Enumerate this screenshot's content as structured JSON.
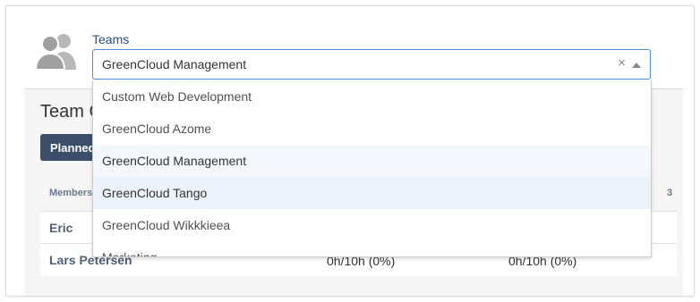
{
  "teams_field": {
    "label": "Teams",
    "selected_value": "GreenCloud Management",
    "clear_symbol": "×"
  },
  "dropdown": {
    "options": [
      {
        "label": "Custom Web Development",
        "state": "normal"
      },
      {
        "label": "GreenCloud Azome",
        "state": "normal"
      },
      {
        "label": "GreenCloud Management",
        "state": "selected"
      },
      {
        "label": "GreenCloud Tango",
        "state": "hovered"
      },
      {
        "label": "GreenCloud Wikkkieea",
        "state": "normal"
      },
      {
        "label": "Marketing",
        "state": "normal"
      }
    ]
  },
  "page": {
    "heading_partial": "Team C",
    "planned_button_label": "Planned"
  },
  "table": {
    "header_members": "Members",
    "header_right_partial": "3",
    "rows": [
      {
        "name": "Eric",
        "val1": "",
        "val2": ""
      },
      {
        "name": "Lars Petersen",
        "val1": "0h/10h (0%)",
        "val2": "0h/10h (0%)"
      }
    ]
  },
  "colors": {
    "accent_blue": "#205081",
    "focus_border": "#4a90d9",
    "button_bg": "#3b4f6b",
    "hover_bg": "#ebf2f9"
  },
  "icons": {
    "avatar": "team-users-icon",
    "clear": "close-icon",
    "dropdown_arrow": "caret-up-icon"
  }
}
